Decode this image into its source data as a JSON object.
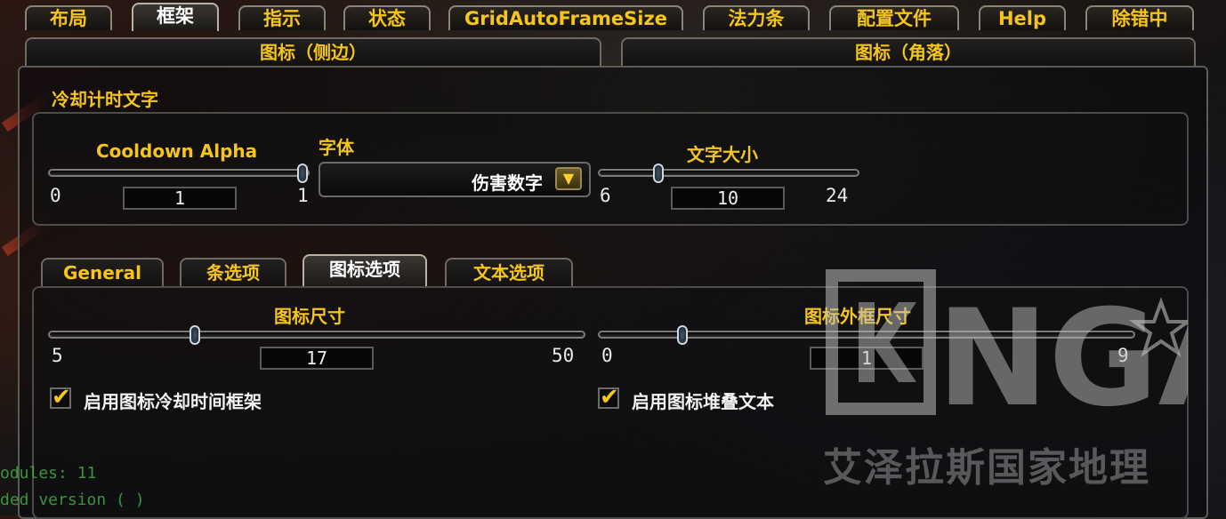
{
  "tabs": [
    "布局",
    "框架",
    "指示",
    "状态",
    "GridAutoFrameSize",
    "法力条",
    "配置文件",
    "Help",
    "除错中"
  ],
  "active_tab_index": 1,
  "subtabs": [
    "图标（侧边）",
    "图标（角落）"
  ],
  "cooldown_section": {
    "title": "冷却计时文字",
    "alpha": {
      "label": "Cooldown Alpha",
      "min": "0",
      "max": "1",
      "value": "1",
      "fraction": 1.0
    },
    "font": {
      "label": "字体",
      "value": "伤害数字"
    },
    "size": {
      "label": "文字大小",
      "min": "6",
      "max": "24",
      "value": "10",
      "fraction": 0.22
    }
  },
  "option_tabs": [
    "General",
    "条选项",
    "图标选项",
    "文本选项"
  ],
  "active_option_tab_index": 2,
  "icon_options": {
    "icon_size": {
      "label": "图标尺寸",
      "min": "5",
      "max": "50",
      "value": "17",
      "fraction": 0.27
    },
    "border_size": {
      "label": "图标外框尺寸",
      "min": "0",
      "max": "9",
      "value": "1",
      "fraction": 0.15
    },
    "cooldown_frame_checkbox": {
      "label": "启用图标冷却时间框架",
      "checked": true
    },
    "stack_text_checkbox": {
      "label": "启用图标堆叠文本",
      "checked": true
    }
  },
  "watermark": {
    "logo": "NGA",
    "caption": "艾泽拉斯国家地理"
  },
  "console_lines": [
    "odules: 11",
    "ded  version  (   )"
  ],
  "colors": {
    "accent": "#f5c518",
    "text_white": "#f2f2f2",
    "panel_border": "#5c5a56"
  }
}
